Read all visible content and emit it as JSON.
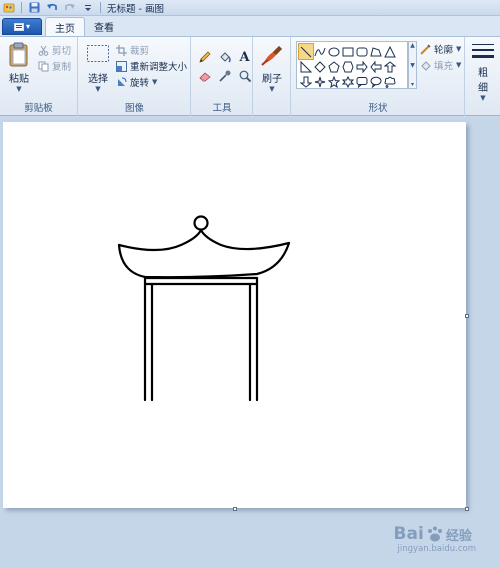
{
  "titlebar": {
    "title": "无标题 - 画图"
  },
  "tabs": {
    "file_arrow": "▾",
    "home": "主页",
    "view": "查看"
  },
  "clipboard": {
    "paste": "粘贴",
    "cut": "剪切",
    "copy": "复制",
    "label": "剪贴板"
  },
  "image": {
    "select": "选择",
    "crop": "裁剪",
    "resize": "重新调整大小",
    "rotate": "旋转",
    "label": "图像"
  },
  "tools": {
    "label": "工具",
    "text_glyph": "A"
  },
  "brushes": {
    "label": "刷子"
  },
  "shapes": {
    "outline": "轮廓",
    "fill": "填充",
    "label": "形状"
  },
  "size": {
    "label_top": "粗",
    "label_bottom": "细"
  },
  "watermark": {
    "brand_left": "Bai",
    "brand_right": "经验",
    "sub": "jingyan.baidu.com"
  },
  "colors": {
    "accent": "#1d57ad",
    "canvas": "#ffffff",
    "workspace": "#c6d6e9"
  }
}
